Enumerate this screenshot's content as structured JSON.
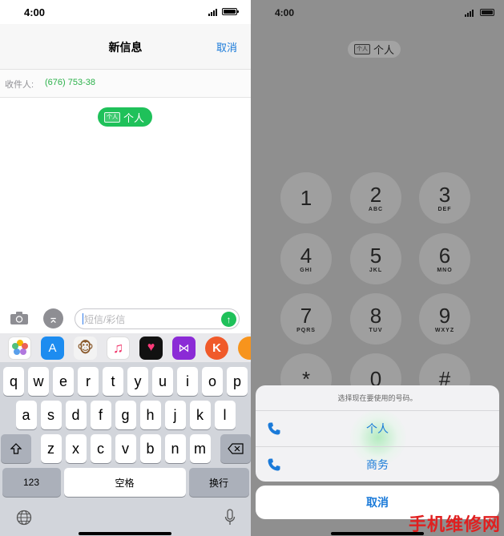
{
  "left": {
    "status": {
      "time": "4:00"
    },
    "nav": {
      "title": "新信息",
      "cancel": "取消"
    },
    "recipient": {
      "label": "收件人:",
      "number": "(676) 753-38"
    },
    "chip": {
      "tag": "个人",
      "label": "个人"
    },
    "composer": {
      "placeholder": "短信/彩信"
    },
    "apps": [
      "photos-app",
      "app-store-app",
      "animoji-app",
      "music-app",
      "digital-touch-app",
      "bowtie-app",
      "k-app",
      "orange-app"
    ],
    "keyboard": {
      "row1": [
        "q",
        "w",
        "e",
        "r",
        "t",
        "y",
        "u",
        "i",
        "o",
        "p"
      ],
      "row2": [
        "a",
        "s",
        "d",
        "f",
        "g",
        "h",
        "j",
        "k",
        "l"
      ],
      "row3": [
        "z",
        "x",
        "c",
        "v",
        "b",
        "n",
        "m"
      ],
      "numbers_key": "123",
      "space_key": "空格",
      "return_key": "换行"
    }
  },
  "right": {
    "status": {
      "time": "4:00"
    },
    "chip": {
      "tag": "个人",
      "label": "个人"
    },
    "keypad": [
      {
        "digit": "1",
        "letters": ""
      },
      {
        "digit": "2",
        "letters": "ABC"
      },
      {
        "digit": "3",
        "letters": "DEF"
      },
      {
        "digit": "4",
        "letters": "GHI"
      },
      {
        "digit": "5",
        "letters": "JKL"
      },
      {
        "digit": "6",
        "letters": "MNO"
      },
      {
        "digit": "7",
        "letters": "PQRS"
      },
      {
        "digit": "8",
        "letters": "TUV"
      },
      {
        "digit": "9",
        "letters": "WXYZ"
      },
      {
        "digit": "*",
        "letters": ""
      },
      {
        "digit": "0",
        "letters": ""
      },
      {
        "digit": "#",
        "letters": ""
      }
    ],
    "sheet": {
      "hint": "选择现在要使用的号码。",
      "options": [
        "个人",
        "商务"
      ],
      "cancel": "取消"
    }
  },
  "watermark": "手机维修网",
  "colors": {
    "accent_blue": "#1a7ad9",
    "imessage_green": "#1fc15a",
    "watermark_red": "#e02020"
  }
}
